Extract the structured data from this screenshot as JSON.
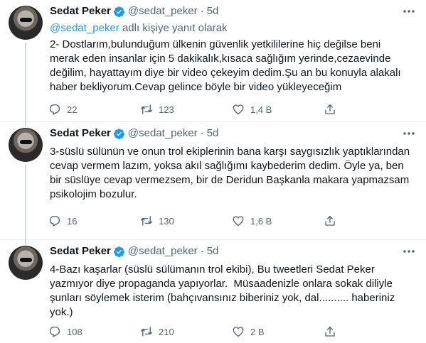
{
  "tweets": [
    {
      "name": "Sedat Peker",
      "handle": "@sedat_peker",
      "dot": "·",
      "time": "5d",
      "replying_link": "@sedat_peker",
      "replying_suffix": " adlı kişiye yanıt olarak",
      "text": "2- Dostlarım,bulunduğum ülkenin güvenlik yetkililerine hiç değilse beni\nmerak eden insanlar için 5 dakikalık,kısaca sağlığım yerinde,cezaevinde\ndeğilim, hayattayım diye bir video çekeyim dedim.Şu an bu konuyla alakalı\nhaber bekliyorum.Cevap gelince böyle bir video yükleyeceğim",
      "replies": "22",
      "retweets": "123",
      "likes": "1,4 B"
    },
    {
      "name": "Sedat Peker",
      "handle": "@sedat_peker",
      "dot": "·",
      "time": "5d",
      "text": "3-süslü sülünün ve onun trol ekiplerinin bana karşı saygısızlık yaptıklarından\ncevap vermem lazım, yoksa akıl sağlığımı kaybederim dedim. Öyle ya, ben\nbir süslüye cevap vermezsem, bir de Deridun Başkanla makara yapmazsam\npsikolojim bozulur.",
      "replies": "16",
      "retweets": "130",
      "likes": "1,6 B"
    },
    {
      "name": "Sedat Peker",
      "handle": "@sedat_peker",
      "dot": "·",
      "time": "5d",
      "text": "4-Bazı kaşarlar (süslü sülümanın trol ekibi), Bu tweetleri Sedat Peker\nyazmıyor diye propaganda yapıyorlar.  Müsaadenizle onlara sokak diliyle\nşunları söylemek isterim (bahçıvansınız biberiniz yok, dal.......... haberiniz\nyok.)",
      "replies": "108",
      "retweets": "210",
      "likes": "2 B"
    }
  ],
  "icons": {
    "verified": "verified-badge-icon",
    "more": "more-icon",
    "reply": "reply-icon",
    "retweet": "retweet-icon",
    "like": "like-icon",
    "share": "share-icon"
  },
  "colors": {
    "accent": "#1d9bf0",
    "muted": "#536471",
    "text": "#0f1419",
    "border": "#ebeef0"
  }
}
